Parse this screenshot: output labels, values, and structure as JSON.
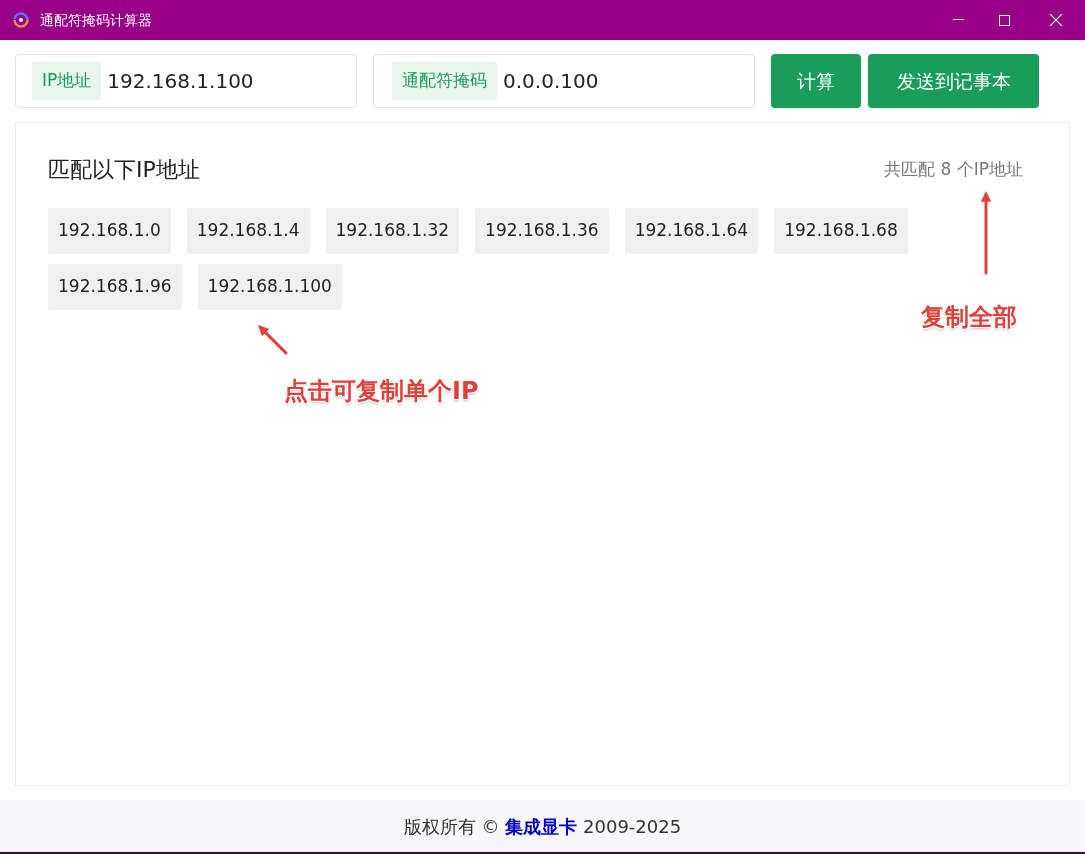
{
  "window": {
    "title": "通配符掩码计算器"
  },
  "ip_field": {
    "label": "IP地址",
    "value": "192.168.1.100"
  },
  "mask_field": {
    "label": "通配符掩码",
    "value": "0.0.0.100"
  },
  "buttons": [
    "计算",
    "发送到记事本"
  ],
  "results": {
    "heading": "匹配以下IP地址",
    "count_text": "共匹配 8 个IP地址",
    "ips": [
      "192.168.1.0",
      "192.168.1.4",
      "192.168.1.32",
      "192.168.1.36",
      "192.168.1.64",
      "192.168.1.68",
      "192.168.1.96",
      "192.168.1.100"
    ]
  },
  "annotations": [
    "复制全部",
    "点击可复制单个IP"
  ],
  "footer": {
    "prefix": "版权所有 © ",
    "link": "集成显卡",
    "suffix": " 2009-2025"
  }
}
